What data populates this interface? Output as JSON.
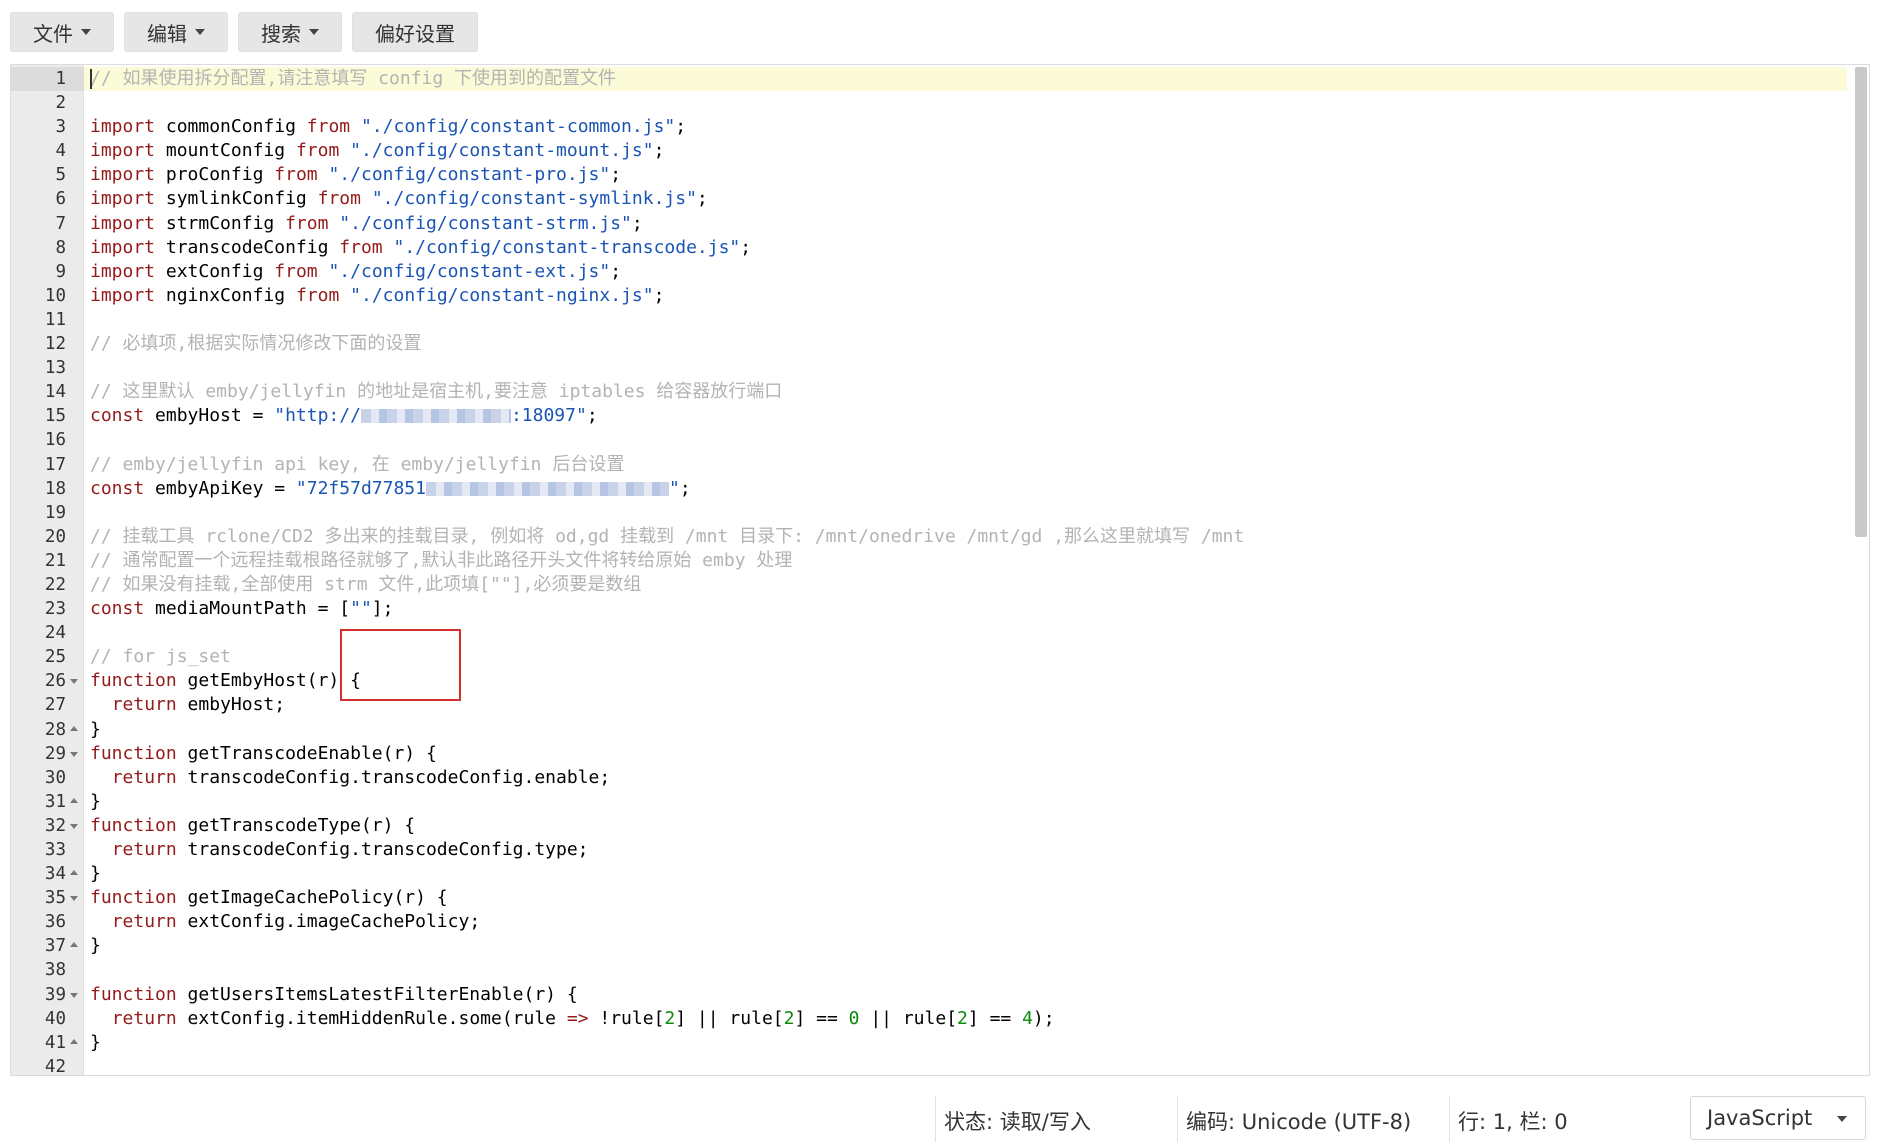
{
  "toolbar": {
    "file": "文件",
    "edit": "编辑",
    "search": "搜索",
    "prefs": "偏好设置"
  },
  "editor": {
    "line_numbers": [
      "1",
      "2",
      "3",
      "4",
      "5",
      "6",
      "7",
      "8",
      "9",
      "10",
      "11",
      "12",
      "13",
      "14",
      "15",
      "16",
      "17",
      "18",
      "19",
      "20",
      "21",
      "22",
      "23",
      "24",
      "25",
      "26",
      "27",
      "28",
      "29",
      "30",
      "31",
      "32",
      "33",
      "34",
      "35",
      "36",
      "37",
      "38",
      "39",
      "40",
      "41",
      "42"
    ],
    "code": {
      "l1": "// 如果使用拆分配置,请注意填写 config 下使用到的配置文件",
      "import_kw": "import",
      "from_kw": "from",
      "l3_id": "commonConfig",
      "l3_str": "\"./config/constant-common.js\"",
      "l4_id": "mountConfig",
      "l4_str": "\"./config/constant-mount.js\"",
      "l5_id": "proConfig",
      "l5_str": "\"./config/constant-pro.js\"",
      "l6_id": "symlinkConfig",
      "l6_str": "\"./config/constant-symlink.js\"",
      "l7_id": "strmConfig",
      "l7_str": "\"./config/constant-strm.js\"",
      "l8_id": "transcodeConfig",
      "l8_str": "\"./config/constant-transcode.js\"",
      "l9_id": "extConfig",
      "l9_str": "\"./config/constant-ext.js\"",
      "l10_id": "nginxConfig",
      "l10_str": "\"./config/constant-nginx.js\"",
      "semicolon": ";",
      "l12": "// 必填项,根据实际情况修改下面的设置",
      "l14": "// 这里默认 emby/jellyfin 的地址是宿主机,要注意 iptables 给容器放行端口",
      "const_kw": "const",
      "l15_id": "embyHost = ",
      "l15_str_a": "\"http://",
      "l15_str_b": ":18097\"",
      "l17": "// emby/jellyfin api key, 在 emby/jellyfin 后台设置",
      "l18_id": "embyApiKey = ",
      "l18_str_a": "\"72f57d77851",
      "l18_str_b": "\"",
      "l20": "// 挂载工具 rclone/CD2 多出来的挂载目录, 例如将 od,gd 挂载到 /mnt 目录下: /mnt/onedrive /mnt/gd ,那么这里就填写 /mnt",
      "l21": "// 通常配置一个远程挂载根路径就够了,默认非此路径开头文件将转给原始 emby 处理",
      "l22": "// 如果没有挂载,全部使用 strm 文件,此项填[\"\"],必须要是数组",
      "l23_id": "mediaMountPath = [",
      "l23_str": "\"\"",
      "l23_end": "];",
      "l25": "// for js_set",
      "function_kw": "function",
      "return_kw": "return",
      "l26_rest": " getEmbyHost(r) {",
      "l27_rest": " embyHost;",
      "brace_close": "}",
      "l29_rest": " getTranscodeEnable(r) {",
      "l30_rest": " transcodeConfig.transcodeConfig.enable;",
      "l32_rest": " getTranscodeType(r) {",
      "l33_rest": " transcodeConfig.transcodeConfig.type;",
      "l35_rest": " getImageCachePolicy(r) {",
      "l36_rest": " extConfig.imageCachePolicy;",
      "l39_rest": " getUsersItemsLatestFilterEnable(r) {",
      "l40_a": " extConfig.itemHiddenRule.some(rule ",
      "l40_arrow": "=>",
      "l40_b": " !rule[",
      "l40_n2": "2",
      "l40_c": "] || rule[",
      "l40_d": "] == ",
      "l40_n0": "0",
      "l40_e": " || rule[",
      "l40_n4": "4",
      "l40_f": ");"
    }
  },
  "statusbar": {
    "state": "状态: 读取/写入",
    "encoding": "编码: Unicode (UTF-8)",
    "position": "行: 1, 栏: 0",
    "language": "JavaScript"
  }
}
